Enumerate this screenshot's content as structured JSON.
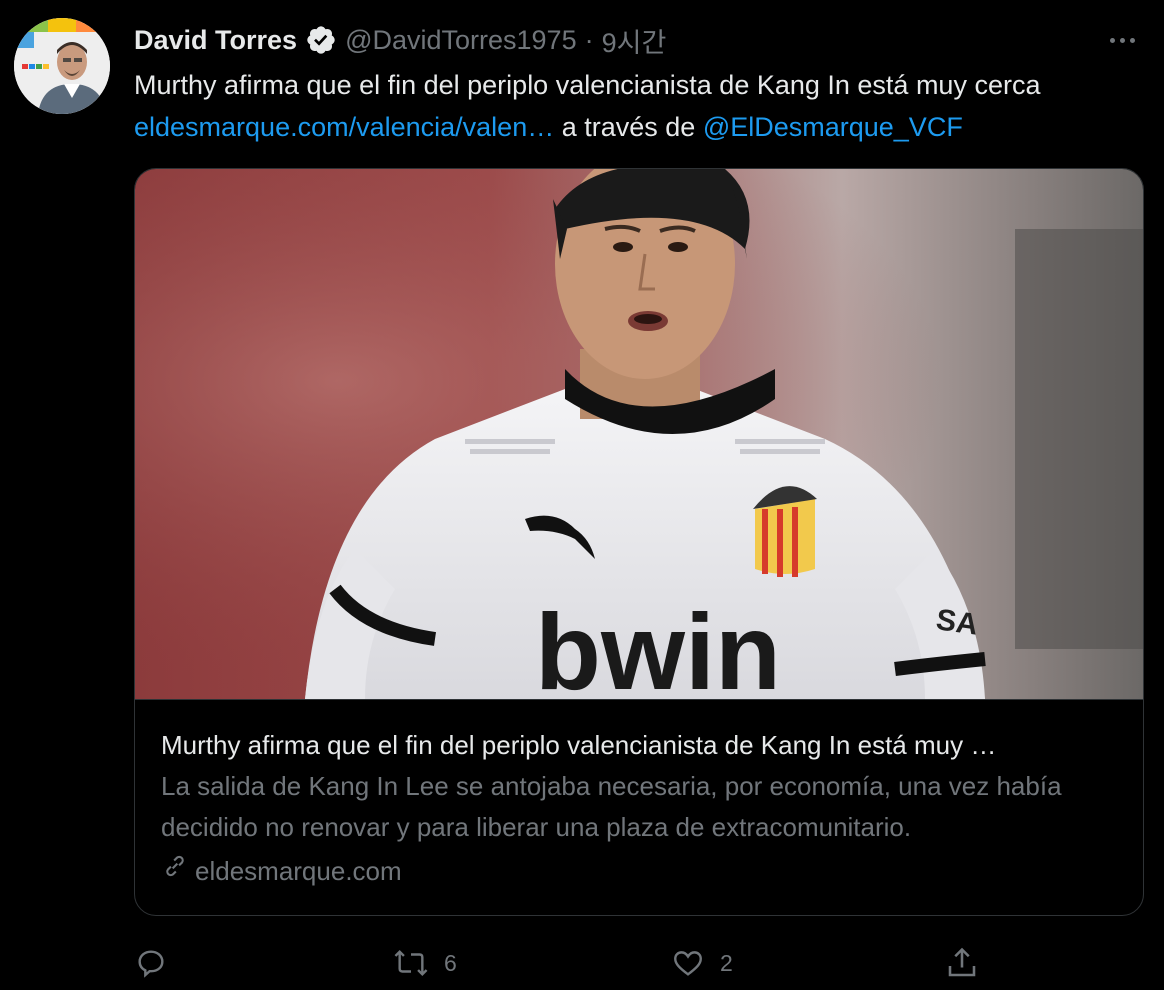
{
  "user": {
    "name": "David Torres",
    "handle": "@DavidTorres1975",
    "separator": "·",
    "time": "9시간"
  },
  "tweet": {
    "text_line1": "Murthy afirma que el fin del periplo valencianista de Kang In está muy cerca",
    "link_text": "eldesmarque.com/valencia/valen…",
    "via_text": " a través de ",
    "mention": "@ElDesmarque_VCF"
  },
  "card": {
    "title": "Murthy afirma que el fin del periplo valencianista de Kang In está muy …",
    "description": "La salida de Kang In Lee se antojaba necesaria, por economía, una vez había decidido no renovar y para liberar una plaza de extracomunitario.",
    "domain": "eldesmarque.com",
    "image_alt": "Kang In Lee in white Valencia jersey",
    "jersey_sponsor": "bwin"
  },
  "actions": {
    "reply_count": "",
    "retweet_count": "6",
    "like_count": "2"
  },
  "icons": {
    "verified": "verified-badge-icon",
    "more": "more-icon",
    "reply": "reply-icon",
    "retweet": "retweet-icon",
    "like": "like-icon",
    "share": "share-icon",
    "link": "link-icon"
  },
  "colors": {
    "background": "#000000",
    "text": "#e7e9ea",
    "secondary": "#71767b",
    "link": "#1d9bf0",
    "border": "#2f3336"
  }
}
